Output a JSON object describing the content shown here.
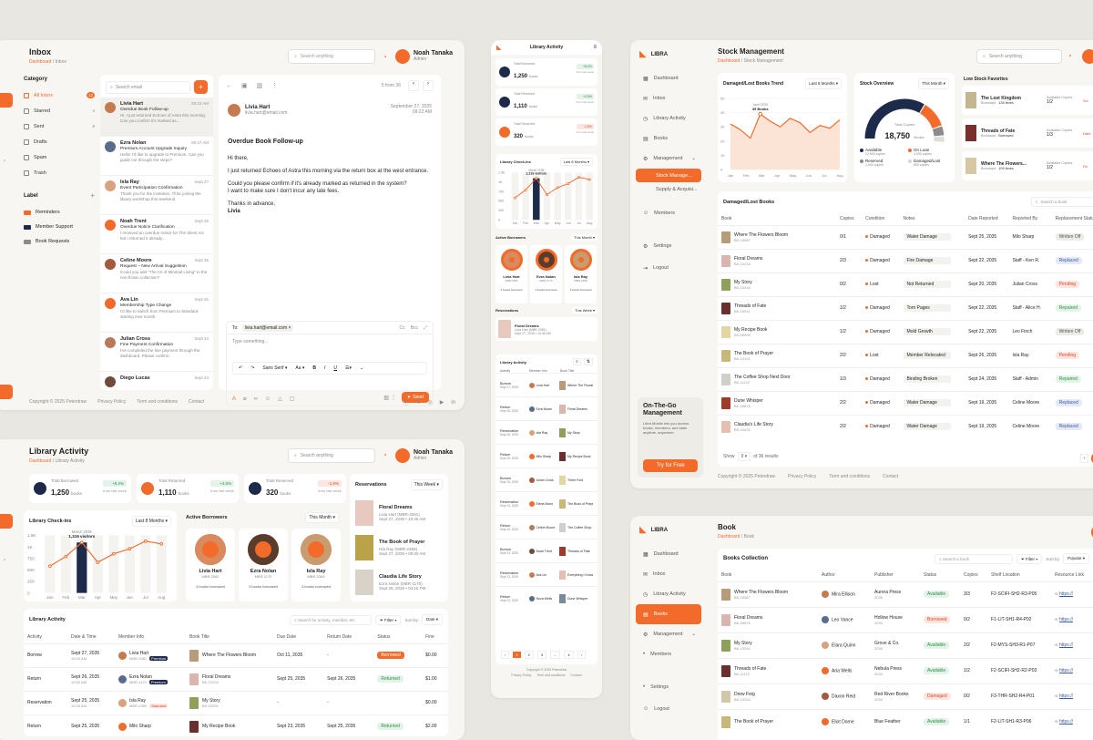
{
  "inbox": {
    "title": "Inbox",
    "crumb_home": "Dashboard",
    "crumb_sep": " / ",
    "crumb_current": "Inbox",
    "search_placeholder": "Search anything",
    "user_name": "Noah Tanaka",
    "user_role": "Admin",
    "category_label": "Category",
    "categories": [
      {
        "label": "All Inbox",
        "count": "12"
      },
      {
        "label": "Starred",
        "count": "4"
      },
      {
        "label": "Sent",
        "count": "8"
      },
      {
        "label": "Drafts",
        "count": ""
      },
      {
        "label": "Spam",
        "count": ""
      },
      {
        "label": "Trash",
        "count": ""
      }
    ],
    "label_heading": "Label",
    "labels": [
      {
        "label": "Reminders",
        "color": "#f26b2a"
      },
      {
        "label": "Member Support",
        "color": "#1e2a4a"
      },
      {
        "label": "Book Requests",
        "color": "#8b8b8b"
      }
    ],
    "search_email": "Search email",
    "messages": [
      {
        "name": "Livia Hart",
        "time": "09:22 AM",
        "subject": "Overdue Book Follow-up",
        "preview": "Hi, I just returned Echoes of Astra this morning. Can you confirm it's marked as..."
      },
      {
        "name": "Ezra Nolan",
        "time": "08:47 AM",
        "subject": "Premium Account Upgrade Inquiry",
        "preview": "Hello! I'd like to upgrade to Premium. Can you guide me through the steps?"
      },
      {
        "name": "Isla Ray",
        "time": "Sept 27",
        "subject": "Event Participation Confirmation",
        "preview": "Thank you for the invitation, I'll be joining the library workshop this weekend."
      },
      {
        "name": "Noah Trent",
        "time": "Sept 26",
        "subject": "Overdue Notice Clarification",
        "preview": "I received an overdue notice for The Silent Arc but I returned it already..."
      },
      {
        "name": "Celine Moore",
        "time": "Sept 26",
        "subject": "Request – New Arrival Suggestion",
        "preview": "Could you add \"The Art of Minimal Living\" to the non-fiction collection?"
      },
      {
        "name": "Ava Lin",
        "time": "Sept 25",
        "subject": "Membership Type Change",
        "preview": "I'd like to switch from Premium to Standard starting next month."
      },
      {
        "name": "Julian Cross",
        "time": "Sept 24",
        "subject": "Fine Payment Confirmation",
        "preview": "I've completed the fine payment through the dashboard. Please confirm."
      },
      {
        "name": "Diego Lucas",
        "time": "Sept 24",
        "subject": "",
        "preview": ""
      }
    ],
    "pager": "5 from 36",
    "sender": "Livia Hart",
    "sender_email": "livia.hart@email.com",
    "mail_date": "September 27, 2035",
    "mail_time": "09:22 AM",
    "mail_subject": "Overdue Book Follow-up",
    "body": [
      "Hi there,",
      "I just returned Echoes of Astra this morning via the return box at the west entrance.",
      "Could you please confirm if it's already marked as returned in the system?",
      "I want to make sure I don't incur any late fees.",
      "Thanks in advance,",
      "Livia"
    ],
    "to_label": "To:",
    "to_value": "livia.hart@email.com",
    "cc": "Cc",
    "bcc": "Bcc",
    "compose_placeholder": "Type something...",
    "font": "Sans Serif",
    "send": "Send",
    "footer_copy": "Copyright © 2025 Peterdraw",
    "footer_links": [
      "Privacy Policy",
      "Term and conditions",
      "Contact"
    ]
  },
  "mobile": {
    "title": "Library Activity",
    "stats": [
      {
        "label": "Total Borrowed",
        "value": "1,250",
        "unit": "books",
        "delta": "+8.2%",
        "sub": "from last week"
      },
      {
        "label": "Total Returned",
        "value": "1,110",
        "unit": "books",
        "delta": "+4.5%",
        "sub": "from last week"
      },
      {
        "label": "Total Reserved",
        "value": "320",
        "unit": "books",
        "delta": "-1.5%",
        "sub": "from last week"
      }
    ],
    "checkins": "Library Check-ins",
    "period": "Last 8 Months",
    "bar_note": "1,316 visitors",
    "bar_month": "March 2035",
    "yticks": [
      "1.5K",
      "1K",
      "750",
      "500",
      "250",
      "0"
    ],
    "months": [
      "Jan",
      "Feb",
      "Mar",
      "Apr",
      "May",
      "Jun",
      "Jul",
      "Aug"
    ],
    "borrowers_title": "Active Borrowers",
    "borrowers_period": "This Month",
    "borrowers": [
      {
        "name": "Livia Hart",
        "id": "MBR-2081",
        "books": "4 books borrowed"
      },
      {
        "name": "Ezra Nolan",
        "id": "MBR-1170",
        "books": "3 books borrowed"
      },
      {
        "name": "Isla Ray",
        "id": "MBR-2389",
        "books": "3 books borrowed"
      }
    ],
    "res_title": "Reservations",
    "res_period": "This Week",
    "res_item": {
      "title": "Floral Dreams",
      "who": "Livia Hart (MBR-2081)",
      "date": "Sept 27, 2035 • 10:45 AM"
    },
    "act_title": "Library Activity",
    "act_head": [
      "Activity",
      "Member Info",
      "Book Title"
    ],
    "acts": [
      {
        "a": "Borrow",
        "d": "Sept 27, 2035",
        "m": "Livia Hart",
        "b": "Where The Flowers Bloom"
      },
      {
        "a": "Return",
        "d": "Sept 26, 2035",
        "m": "Ezra Nolan",
        "b": "Floral Dreams"
      },
      {
        "a": "Reservation",
        "d": "Sept 26, 2035",
        "m": "Isla Ray",
        "b": "My Story"
      },
      {
        "a": "Return",
        "d": "Sept 25, 2035",
        "m": "Milo Sharp",
        "b": "My Recipe Book"
      },
      {
        "a": "Borrow",
        "d": "Sept 25, 2035",
        "m": "Julian Cross",
        "b": "Three Fold"
      },
      {
        "a": "Reservation",
        "d": "Sept 24, 2035",
        "m": "Elena Moon",
        "b": "The Book of Prayer"
      },
      {
        "a": "Return",
        "d": "Sept 24, 2035",
        "m": "Celine Moore",
        "b": "The Coffee Shop"
      },
      {
        "a": "Borrow",
        "d": "Sept 23, 2035",
        "m": "Noah Trent",
        "b": "Threads of Fate"
      },
      {
        "a": "Reservation",
        "d": "Sept 23, 2035",
        "m": "Ava Lin",
        "b": "Everything I Know"
      },
      {
        "a": "Return",
        "d": "Sept 22, 2035",
        "m": "Nova Wells",
        "b": "Dune Whisper"
      }
    ],
    "pages": [
      "1",
      "2",
      "3",
      "...",
      "4"
    ],
    "footer": "Copyright © 2025 Peterdraw",
    "flinks": [
      "Privacy Policy",
      "Term and conditions",
      "Contact"
    ]
  },
  "stock": {
    "brand": "LIBRA",
    "title": "Stock Management",
    "crumb_home": "Dashboard",
    "crumb_current": "Stock Management",
    "search_placeholder": "Search anything",
    "nav": [
      "Dashboard",
      "Inbox",
      "Library Activity",
      "Books",
      "Management",
      "Stock Manage...",
      "Supply & Acquisi...",
      "Members",
      "Settings",
      "Logout"
    ],
    "trend_title": "Damaged/Lost Books Trend",
    "trend_period": "Last 8 Months",
    "trend_note": "39 Books",
    "trend_month": "April 2035",
    "trend_y": [
      "50",
      "40",
      "30",
      "20",
      "10",
      "0"
    ],
    "trend_x": [
      "Jan",
      "Feb",
      "Mar",
      "Apr",
      "May",
      "Jun",
      "Jul",
      "Aug"
    ],
    "overview_title": "Stock Overview",
    "overview_period": "This Month",
    "total_label": "Total Copies",
    "total": "18,750",
    "total_unit": "Books",
    "legend": [
      {
        "label": "Available",
        "value": "12,500 copies",
        "color": "#1e2a4a"
      },
      {
        "label": "On Loan",
        "value": "4,000 copies",
        "color": "#f26b2a"
      },
      {
        "label": "Reserved",
        "value": "1,400 copies",
        "color": "#8b8b8b"
      },
      {
        "label": "Damaged/Lost",
        "value": "850 copies",
        "color": "#d9d6cf"
      }
    ],
    "low_title": "Low Stock Favorites",
    "low": [
      {
        "title": "The Lost Kingdom",
        "borrowed": "128 times",
        "avail": "1/2",
        "cl": "Sci"
      },
      {
        "title": "Threads of Fate",
        "borrowed": "Borrowed",
        "avail": "1/3",
        "cl": "Dark"
      },
      {
        "title": "Where The Flowers...",
        "borrowed": "109 times",
        "avail": "1/2",
        "cl": "Fic"
      }
    ],
    "low_avail_label": "Available Copies",
    "low_borrowed_label": "Borrowed",
    "promo_title": "On-The-Go Management",
    "promo_text": "Libra Mobile lets you access books, members, and stats anytime, anywhere.",
    "promo_btn": "Try for Free",
    "table_title": "Damaged/Lost Books",
    "search_book": "Search a book",
    "head": [
      "Book",
      "Copies",
      "Condition",
      "Notes",
      "Date Reported",
      "Reported By",
      "Replacement Status"
    ],
    "rows": [
      {
        "t": "Where The Flowers Bloom",
        "id": "BK-10567",
        "c": "0/1",
        "cond": "Damaged",
        "note": "Water Damage",
        "date": "Sept 25, 2035",
        "by": "Milo Sharp",
        "st": "Written Off"
      },
      {
        "t": "Floral Dreams",
        "id": "BK-10234",
        "c": "2/3",
        "cond": "Damaged",
        "note": "Fire Damage",
        "date": "Sept 22, 2035",
        "by": "Staff - Ken R.",
        "st": "Replaced"
      },
      {
        "t": "My Story",
        "id": "BK-10345",
        "c": "0/2",
        "cond": "Lost",
        "note": "Not Returned",
        "date": "Sept 20, 2035",
        "by": "Julian Cross",
        "st": "Pending"
      },
      {
        "t": "Threads of Fate",
        "id": "BK-10911",
        "c": "1/2",
        "cond": "Damaged",
        "note": "Torn Pages",
        "date": "Sept 22, 2035",
        "by": "Staff - Alice H.",
        "st": "Repaired"
      },
      {
        "t": "My Recipe Book",
        "id": "BK-09999",
        "c": "1/2",
        "cond": "Damaged",
        "note": "Mold Growth",
        "date": "Sept 22, 2035",
        "by": "Leo Finch",
        "st": "Written Off"
      },
      {
        "t": "The Book of Prayer",
        "id": "BK-10101",
        "c": "2/2",
        "cond": "Lost",
        "note": "Member Relocated",
        "date": "Sept 26, 2035",
        "by": "Isla Ray",
        "st": "Pending"
      },
      {
        "t": "The Coffee Shop Next Door",
        "id": "BK-11122",
        "c": "1/3",
        "cond": "Damaged",
        "note": "Binding Broken",
        "date": "Sept 24, 2035",
        "by": "Staff - Admin",
        "st": "Repaired"
      },
      {
        "t": "Dune Whisper",
        "id": "BK-09876",
        "c": "2/2",
        "cond": "Damaged",
        "note": "Water Damage",
        "date": "Sept 19, 2035",
        "by": "Celine Moore",
        "st": "Replaced"
      },
      {
        "t": "Claudia's Life Story",
        "id": "BK-10432",
        "c": "2/2",
        "cond": "Damaged",
        "note": "Water Damage",
        "date": "Sept 19, 2035",
        "by": "Celine Moore",
        "st": "Replaced"
      }
    ],
    "show": "Show",
    "show_n": "9",
    "show_of": "of 36 results",
    "footer": "Copyright © 2025 Peterdraw",
    "flinks": [
      "Privacy Policy",
      "Term and conditions",
      "Contact"
    ]
  },
  "activity": {
    "title": "Library Activity",
    "crumb_home": "Dashboard",
    "crumb_current": "Library Activity",
    "search_placeholder": "Search anything",
    "user_name": "Noah Tanaka",
    "user_role": "Admin",
    "stats": [
      {
        "label": "Total Borrowed",
        "value": "1,250",
        "unit": "books",
        "delta": "+8.2%",
        "sub": "from last week"
      },
      {
        "label": "Total Returned",
        "value": "1,110",
        "unit": "books",
        "delta": "+4.5%",
        "sub": "from last week"
      },
      {
        "label": "Total Reserved",
        "value": "320",
        "unit": "books",
        "delta": "-1.5%",
        "sub": "from last week"
      }
    ],
    "checkins": "Library Check-ins",
    "period": "Last 8 Months",
    "bar_month": "March 2035",
    "bar_note": "1,316 visitors",
    "yticks": [
      "1.5K",
      "1K",
      "750",
      "500",
      "250",
      "0"
    ],
    "months": [
      "Jan",
      "Feb",
      "Mar",
      "Apr",
      "May",
      "Jun",
      "Jul",
      "Aug"
    ],
    "borrowers_title": "Active Borrowers",
    "borrowers_period": "This Month",
    "borrowers": [
      {
        "name": "Livia Hart",
        "id": "MBR-2081",
        "books": "4 books borrowed"
      },
      {
        "name": "Ezra Nolan",
        "id": "MBR-1170",
        "books": "3 books borrowed"
      },
      {
        "name": "Isla Ray",
        "id": "MBR-2389",
        "books": "3 books borrowed"
      }
    ],
    "res_title": "Reservations",
    "res_period": "This Week",
    "res": [
      {
        "t": "Floral Dreams",
        "w": "Livia Hart (MBR-2081)",
        "d": "Sept 27, 2035 • 10:45 AM"
      },
      {
        "t": "The Book of Prayer",
        "w": "Isla Ray (MBR-2389)",
        "d": "Sept 27, 2035 • 09:30 AM"
      },
      {
        "t": "Claudia Life Story",
        "w": "Ezra Nolan (MBR-1170)",
        "d": "Sept 26, 2035 • 04:15 PM"
      }
    ],
    "table_title": "Library Activity",
    "table_search": "Search for activity, member, etc",
    "filter": "Filter",
    "sort_by": "Sort by:",
    "sort_val": "Date",
    "head": [
      "Activity",
      "Date & Time",
      "Member Info",
      "Book Title",
      "Due Date",
      "Return Date",
      "Status",
      "Fine"
    ],
    "rows": [
      {
        "a": "Borrow",
        "d": "Sept 27, 2035",
        "tm": "10:00 AM",
        "m": "Livia Hart",
        "id": "MBR-2081",
        "tier": "Premium",
        "b": "Where The Flowers Bloom",
        "bid": "",
        "due": "Oct 11, 2035",
        "ret": "-",
        "st": "Borrowed",
        "fine": "$0.00"
      },
      {
        "a": "Return",
        "d": "Sept 26, 2035",
        "tm": "10:00 AM",
        "m": "Ezra Nolan",
        "id": "MBR-1170",
        "tier": "Premium",
        "b": "Floral Dreams",
        "bid": "BK-10234",
        "due": "Sept 25, 2035",
        "ret": "Sept 26, 2035",
        "st": "Returned",
        "fine": "$1.00"
      },
      {
        "a": "Reservation",
        "d": "Sept 25, 2035",
        "tm": "10:00 AM",
        "m": "Isla Ray",
        "id": "MBR-2389",
        "tier": "Standard",
        "b": "My Story",
        "bid": "BK-10001",
        "due": "-",
        "ret": "-",
        "st": "",
        "fine": "$0.00"
      },
      {
        "a": "Return",
        "d": "Sept 25, 2035",
        "tm": "",
        "m": "Milo Sharp",
        "id": "",
        "tier": "",
        "b": "My Recipe Book",
        "bid": "",
        "due": "Sept 23, 2035",
        "ret": "Sept 25, 2035",
        "st": "Returned",
        "fine": "$2.00"
      }
    ]
  },
  "books": {
    "brand": "LIBRA",
    "title": "Book",
    "crumb_home": "Dashboard",
    "crumb_current": "Book",
    "nav": [
      "Dashboard",
      "Inbox",
      "Library Activity",
      "Books",
      "Management",
      "Members",
      "Settings",
      "Logout"
    ],
    "collection": "Books Collection",
    "search_book": "Search a book",
    "filter": "Filter",
    "sort_by": "Sort by:",
    "sort_val": "Popular",
    "head": [
      "Book",
      "Author",
      "Publisher",
      "Status",
      "Copies",
      "Shelf Location",
      "Resource Link"
    ],
    "rows": [
      {
        "t": "Where The Flowers Bloom",
        "id": "BK-10567",
        "a": "Mira Ellison",
        "p": "Aurora Press",
        "py": "2035",
        "s": "Available",
        "c": "3/3",
        "loc": "F2-SCIFI-SH2-R3-P05",
        "link": "https://"
      },
      {
        "t": "Floral Dreams",
        "id": "BK-09876",
        "a": "Leo Vance",
        "p": "Hollow House",
        "py": "2034",
        "s": "Borrowed",
        "c": "0/2",
        "loc": "F1-LIT-SH1-R4-P02",
        "link": "https://"
      },
      {
        "t": "My Story",
        "id": "BK-10001",
        "a": "Elara Quinn",
        "p": "Grove & Co.",
        "py": "2035",
        "s": "Available",
        "c": "2/2",
        "loc": "F2-MYS-SH3-R1-P07",
        "link": "https://"
      },
      {
        "t": "Threads of Fate",
        "id": "BK-11122",
        "a": "Aria Wells",
        "p": "Nebula Press",
        "py": "2033",
        "s": "Available",
        "c": "1/2",
        "loc": "F2-SCIFI-SH2-R2-P03",
        "link": "https://"
      },
      {
        "t": "Drew Feig",
        "id": "BK-10234",
        "a": "Daxon Reid",
        "p": "Red River Books",
        "py": "2035",
        "s": "Damaged",
        "c": "0/2",
        "loc": "F3-THR-SH2-R4-P01",
        "link": "https://"
      },
      {
        "t": "The Book of Prayer",
        "id": "",
        "a": "Eliot Dorne",
        "p": "Blue Feather",
        "py": "",
        "s": "Available",
        "c": "1/1",
        "loc": "F2-LIT-SH1-R3-P06",
        "link": "https://"
      }
    ]
  }
}
